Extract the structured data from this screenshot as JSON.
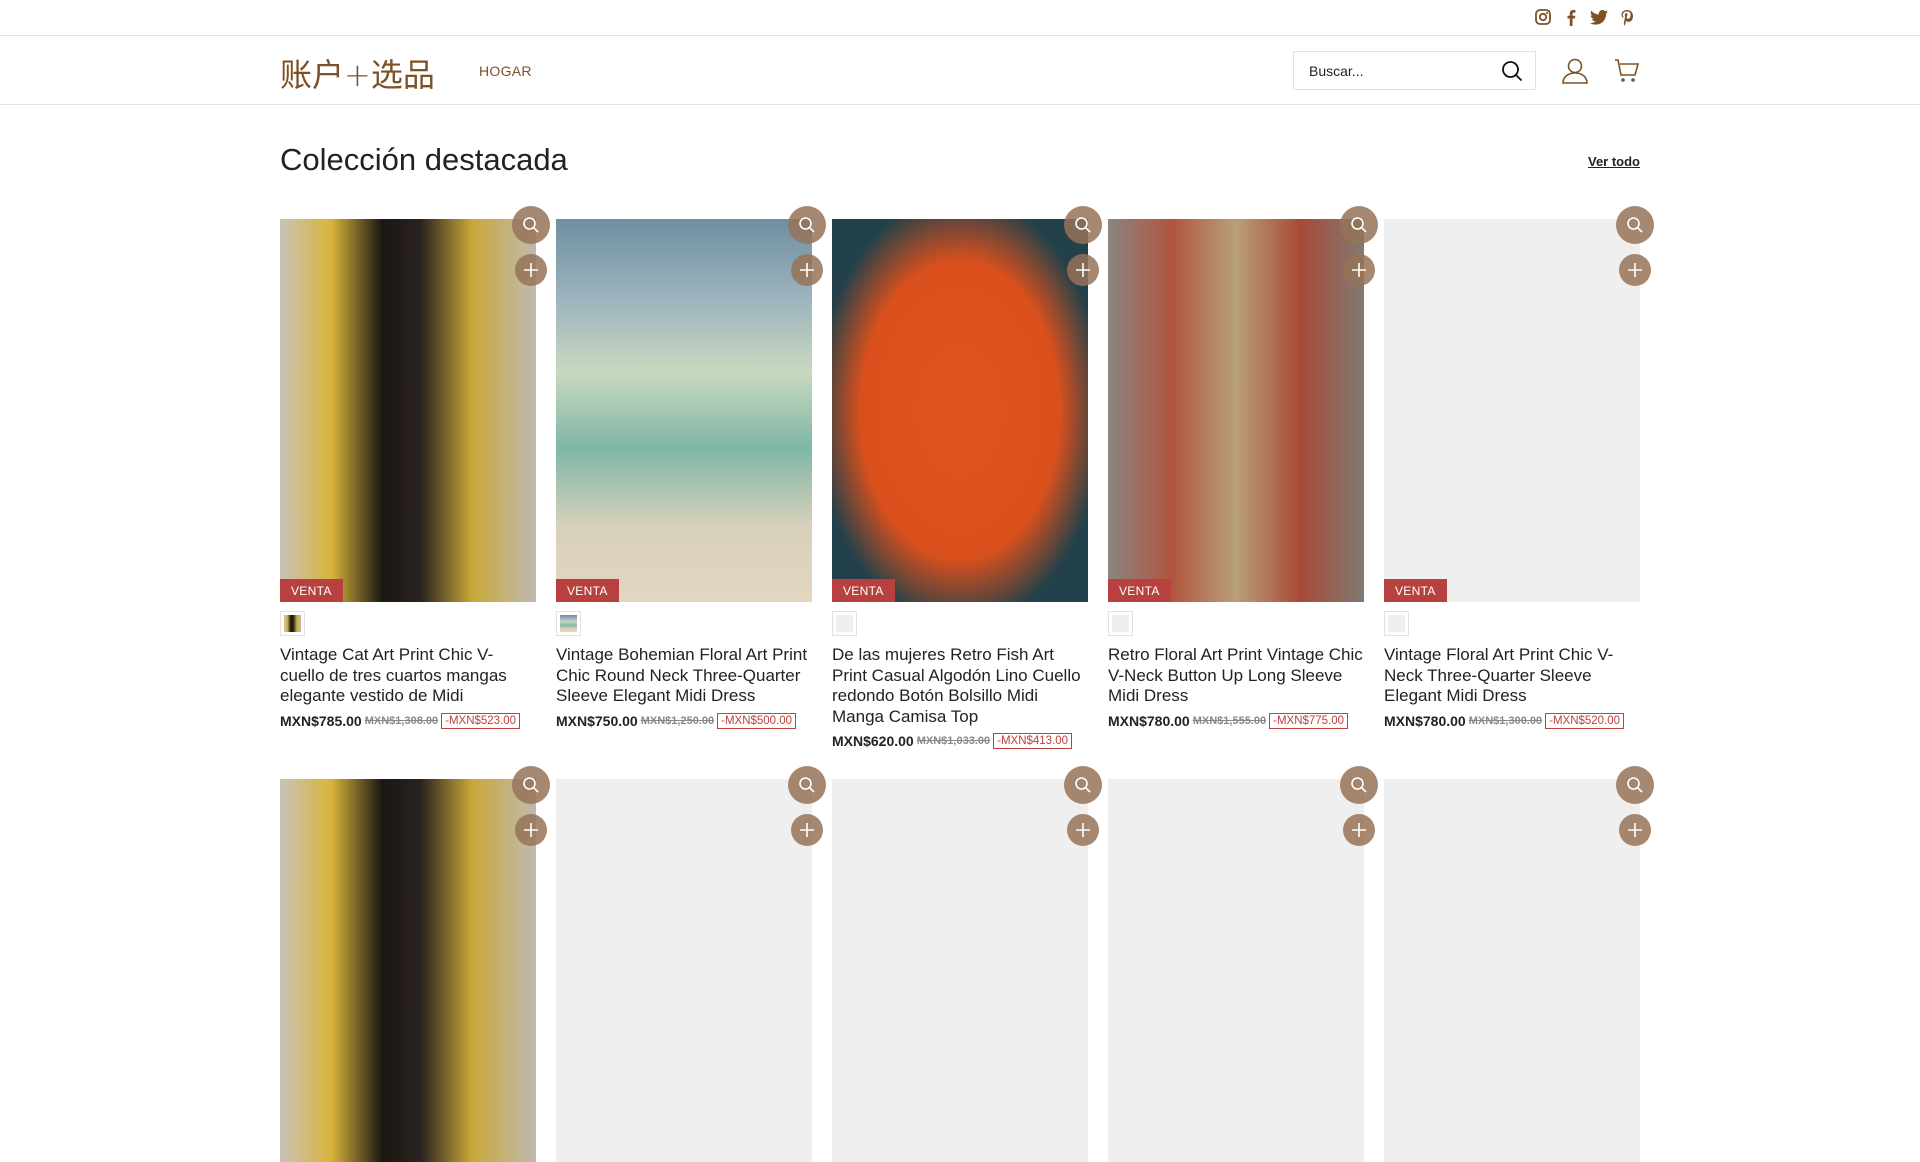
{
  "header": {
    "logo": "账户+选品",
    "nav": [
      {
        "label": "HOGAR"
      }
    ],
    "search_placeholder": "Buscar..."
  },
  "social": [
    "instagram-icon",
    "facebook-icon",
    "twitter-icon",
    "pinterest-icon"
  ],
  "section": {
    "title": "Colección destacada",
    "view_all": "Ver todo"
  },
  "colors": {
    "brand": "#7d5128",
    "sale": "#b8403f"
  },
  "products": [
    {
      "badge": "VENTA",
      "title": "Vintage Cat Art Print Chic V-cuello de tres cuartos mangas elegante vestido de Midi",
      "price": "MXN$785.00",
      "compare": "MXN$1,308.00",
      "saving": "-MXN$523.00"
    },
    {
      "badge": "VENTA",
      "title": "Vintage Bohemian Floral Art Print Chic Round Neck Three-Quarter Sleeve Elegant Midi Dress",
      "price": "MXN$750.00",
      "compare": "MXN$1,250.00",
      "saving": "-MXN$500.00"
    },
    {
      "badge": "VENTA",
      "title": "De las mujeres Retro Fish Art Print Casual Algodón Lino Cuello redondo Botón Bolsillo Midi Manga Camisa Top",
      "price": "MXN$620.00",
      "compare": "MXN$1,033.00",
      "saving": "-MXN$413.00"
    },
    {
      "badge": "VENTA",
      "title": "Retro Floral Art Print Vintage Chic V-Neck Button Up Long Sleeve Midi Dress",
      "price": "MXN$780.00",
      "compare": "MXN$1,555.00",
      "saving": "-MXN$775.00"
    },
    {
      "badge": "VENTA",
      "title": "Vintage Floral Art Print Chic V-Neck Three-Quarter Sleeve Elegant Midi Dress",
      "price": "MXN$780.00",
      "compare": "MXN$1,300.00",
      "saving": "-MXN$520.00"
    }
  ]
}
